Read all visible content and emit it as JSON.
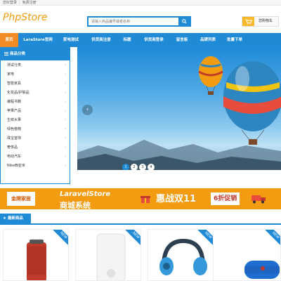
{
  "topbar": {
    "login": "您好登录",
    "register": "免费注册"
  },
  "header": {
    "logo_text": "PhpStore",
    "search_placeholder": "请输入商品编号或者名称",
    "cart_label": "您购物车"
  },
  "nav": {
    "items": [
      "首页",
      "LaraStore官网",
      "家电测试",
      "供货商注册",
      "标题",
      "供货商登录",
      "留言板",
      "品牌列表",
      "批量下单"
    ],
    "active": 0
  },
  "sidebar": {
    "title": "商品分类",
    "categories": [
      "测试分类",
      "家电",
      "智能家具",
      "化妆品/护肤品",
      "编程书籍",
      "苹果产品",
      "生鲜水果",
      "绿色植物",
      "珠宝首饰",
      "奢侈品",
      "电动汽车",
      "Nike西亚米"
    ]
  },
  "banner": {
    "dots": [
      "1",
      "2",
      "3",
      "4"
    ],
    "active_dot": 0
  },
  "promo": {
    "brand": "金牌家居",
    "line1": "LaravelStore",
    "line2": "商城系统",
    "line3": "惠战双11",
    "line4": "6折促销"
  },
  "section": {
    "title": "最新商品"
  },
  "products": [
    {
      "badge": "NEW"
    },
    {
      "badge": "NEW"
    },
    {
      "badge": "NEW"
    },
    {
      "badge": "NEW"
    }
  ],
  "colors": {
    "primary": "#1f8ad6",
    "accent": "#f28b26",
    "promo": "#f39c12"
  }
}
